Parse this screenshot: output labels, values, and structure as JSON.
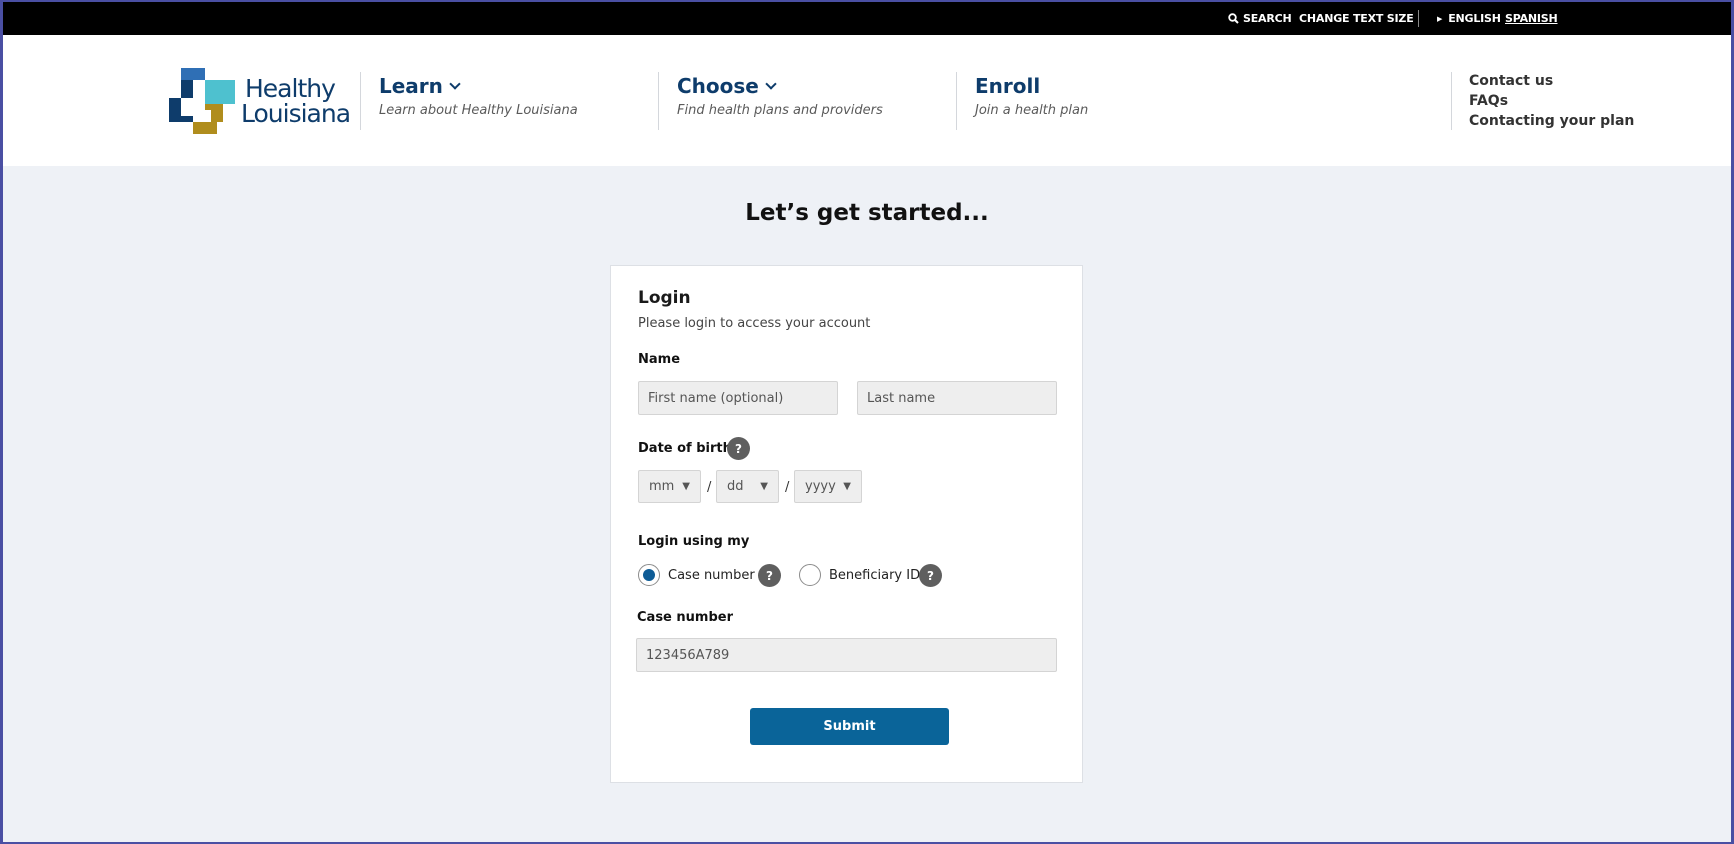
{
  "topbar": {
    "search": "SEARCH",
    "change_text_size": "CHANGE TEXT SIZE",
    "english": "ENGLISH",
    "spanish": "SPANISH"
  },
  "logo": {
    "line1": "Healthy",
    "line2": "Louisiana",
    "colors": [
      "#2f6fb5",
      "#4ec1cf",
      "#0e3c6b",
      "#b08d1d"
    ]
  },
  "nav": [
    {
      "title": "Learn",
      "subtitle": "Learn about Healthy Louisiana"
    },
    {
      "title": "Choose",
      "subtitle": "Find health plans and providers"
    },
    {
      "title": "Enroll",
      "subtitle": "Join a health plan"
    }
  ],
  "quick_links": [
    "Contact us",
    "FAQs",
    "Contacting your plan"
  ],
  "main": {
    "title": "Let’s get started..."
  },
  "login": {
    "heading": "Login",
    "subheading": "Please login to access your account",
    "name_label": "Name",
    "first_name_placeholder": "First name (optional)",
    "last_name_placeholder": "Last name",
    "dob_label": "Date of birth",
    "dob_month": "mm",
    "dob_day": "dd",
    "dob_year": "yyyy",
    "dob_separator": "/",
    "help_glyph": "?",
    "login_using_label": "Login using my",
    "option_case": "Case number",
    "option_beneficiary": "Beneficiary ID",
    "case_number_label": "Case number",
    "case_number_placeholder": "123456A789",
    "submit": "Submit"
  },
  "colors": {
    "brand_navy": "#0e3c6b",
    "button_blue": "#0a6499",
    "page_bg": "#eef1f6"
  }
}
